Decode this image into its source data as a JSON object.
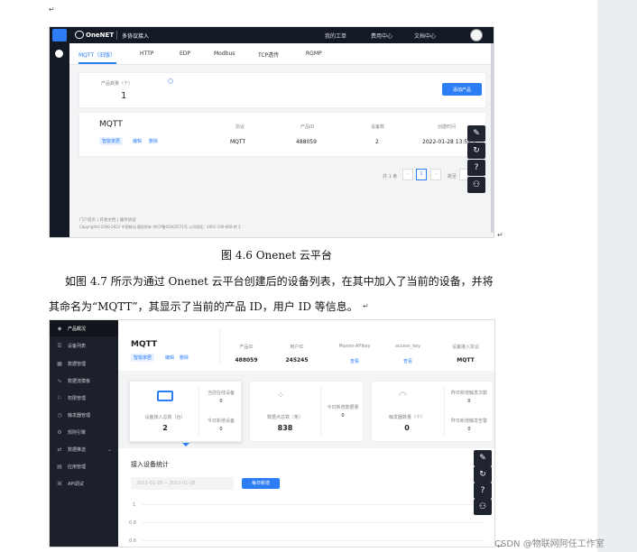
{
  "doc": {
    "marks": [
      "↵",
      "↵",
      "↵",
      "↵",
      "↵"
    ],
    "caption1": "图 4.6 Onenet 云平台",
    "paragraph_line1": "如图 4.7 所示为通过 Onenet 云平台创建后的设备列表，在其中加入了当前的设备，并将",
    "paragraph_line2": "其命名为“MQTT”，其显示了当前的产品 ID，用户 ID 等信息。",
    "watermark": "CSDN @物联网阿任工作室"
  },
  "s1": {
    "brand": "OneNET",
    "section": "多协议接入",
    "nav": [
      "我的工单",
      "费用中心",
      "文档中心"
    ],
    "tabs": [
      "MQTT（旧版）",
      "HTTP",
      "EDP",
      "Modbus",
      "TCP透传",
      "RGMP"
    ],
    "product_count_label": "产品数量（个）",
    "product_count": "1",
    "add_product": "添加产品",
    "product_name": "MQTT",
    "product_tags": [
      "智能家居",
      "编辑",
      "删除"
    ],
    "col_labels": [
      "协议",
      "产品ID",
      "设备数",
      "创建时间"
    ],
    "col_values": [
      "MQTT",
      "488059",
      "2",
      "2022-01-28 13:52:2"
    ],
    "pager": {
      "total": "共 1 条",
      "prev": "‹",
      "page": "1",
      "next": "›",
      "goto": "跳至",
      "suffix": "页"
    },
    "footer1": "门户首页 | 开发文档 | 服务协议",
    "footer2": "Copyright©2000-2022 中国移动 版权所有 京ICP备05002571号 公司电话：4001-100-868 转 3",
    "tools": [
      "✎",
      "↻",
      "?",
      "⚇"
    ]
  },
  "s2": {
    "nav": [
      {
        "label": "产品概况",
        "icon": "◆"
      },
      {
        "label": "设备列表",
        "icon": "☰"
      },
      {
        "label": "数据管理",
        "icon": "▦"
      },
      {
        "label": "数据流模板",
        "icon": "∿"
      },
      {
        "label": "权限管理",
        "icon": "⚐"
      },
      {
        "label": "触发器管理",
        "icon": "◷"
      },
      {
        "label": "规则引擎",
        "icon": "⚙"
      },
      {
        "label": "数据推送",
        "icon": "⇄"
      },
      {
        "label": "应用管理",
        "icon": "▤"
      },
      {
        "label": "API调试",
        "icon": "⌘"
      }
    ],
    "product_name": "MQTT",
    "product_tags": [
      "智能家居",
      "编辑",
      "删除"
    ],
    "info_labels": [
      "产品ID",
      "用户ID",
      "Master-APIkey",
      "access_key",
      "设备接入协议"
    ],
    "info_values": [
      "488059",
      "245245",
      "查看",
      "查看",
      "MQTT"
    ],
    "card1": {
      "main_label": "设备接入总数（台）",
      "main_value": "2",
      "sub": [
        {
          "label": "当前在线设备",
          "value": "0"
        },
        {
          "label": "今日新增设备",
          "value": "0"
        }
      ]
    },
    "card2": {
      "main_label": "数据点总数（条）",
      "main_value": "838",
      "sub": [
        {
          "label": "今日新增数据量",
          "value": "0"
        }
      ]
    },
    "card3": {
      "main_label": "触发器数量（个）",
      "main_value": "0",
      "sub": [
        {
          "label": "昨日新增触发次数",
          "value": "0"
        },
        {
          "label": "昨日新增触发告警",
          "value": "0"
        }
      ]
    },
    "stats_title": "接入设备统计",
    "date_range": "2022-01-28 ~ 2022-01-28",
    "query_button": "每日新增",
    "y_ticks": [
      "1",
      "0.8",
      "0.6"
    ],
    "tools": [
      "✎",
      "↻",
      "?",
      "⚇"
    ]
  },
  "colors": {
    "accent": "#2d7df6",
    "dark_nav": "#141a25",
    "sidebar": "#1c202a"
  },
  "icons": {
    "logo": "onenet-logo-icon",
    "avatar": "user-avatar-icon"
  }
}
